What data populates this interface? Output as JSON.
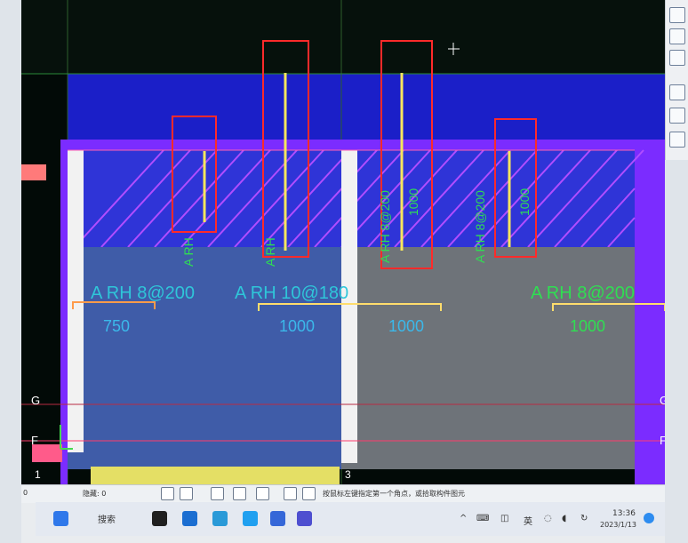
{
  "cad": {
    "grid_labels": {
      "g_left": "G",
      "f_left": "F",
      "g_right": "G",
      "f_right": "F",
      "one": "1",
      "three": "3"
    },
    "rebar_labels": [
      {
        "text": "A RH 8@200",
        "id": "label-1"
      },
      {
        "text": "A RH 10@180",
        "id": "label-2"
      },
      {
        "text": "A RH 8@200",
        "id": "label-3"
      }
    ],
    "dims": [
      "750",
      "1000",
      "1000",
      "1000"
    ],
    "vertical_dims": [
      "1000",
      "1000"
    ],
    "vertical_labels": [
      "A RH",
      "A RH",
      "A RH 8@200",
      "A RH 8@200"
    ],
    "colors": {
      "blue": "#2f34d7",
      "purple": "#7b2cff",
      "cyan_text": "#2fc6d9",
      "green_text": "#2fdf52",
      "yellow": "#f7e65d",
      "pink": "#ff6cae",
      "red_box": "#ff2a2a"
    }
  },
  "status": {
    "left_text": "0",
    "hidden_label": "隐藏: 0",
    "prompt": "按鼠标左键指定第一个角点，或拾取构件图元"
  },
  "taskbar": {
    "search": "搜索",
    "time": "13:36",
    "date": "2023/1/13",
    "lang": "英"
  }
}
